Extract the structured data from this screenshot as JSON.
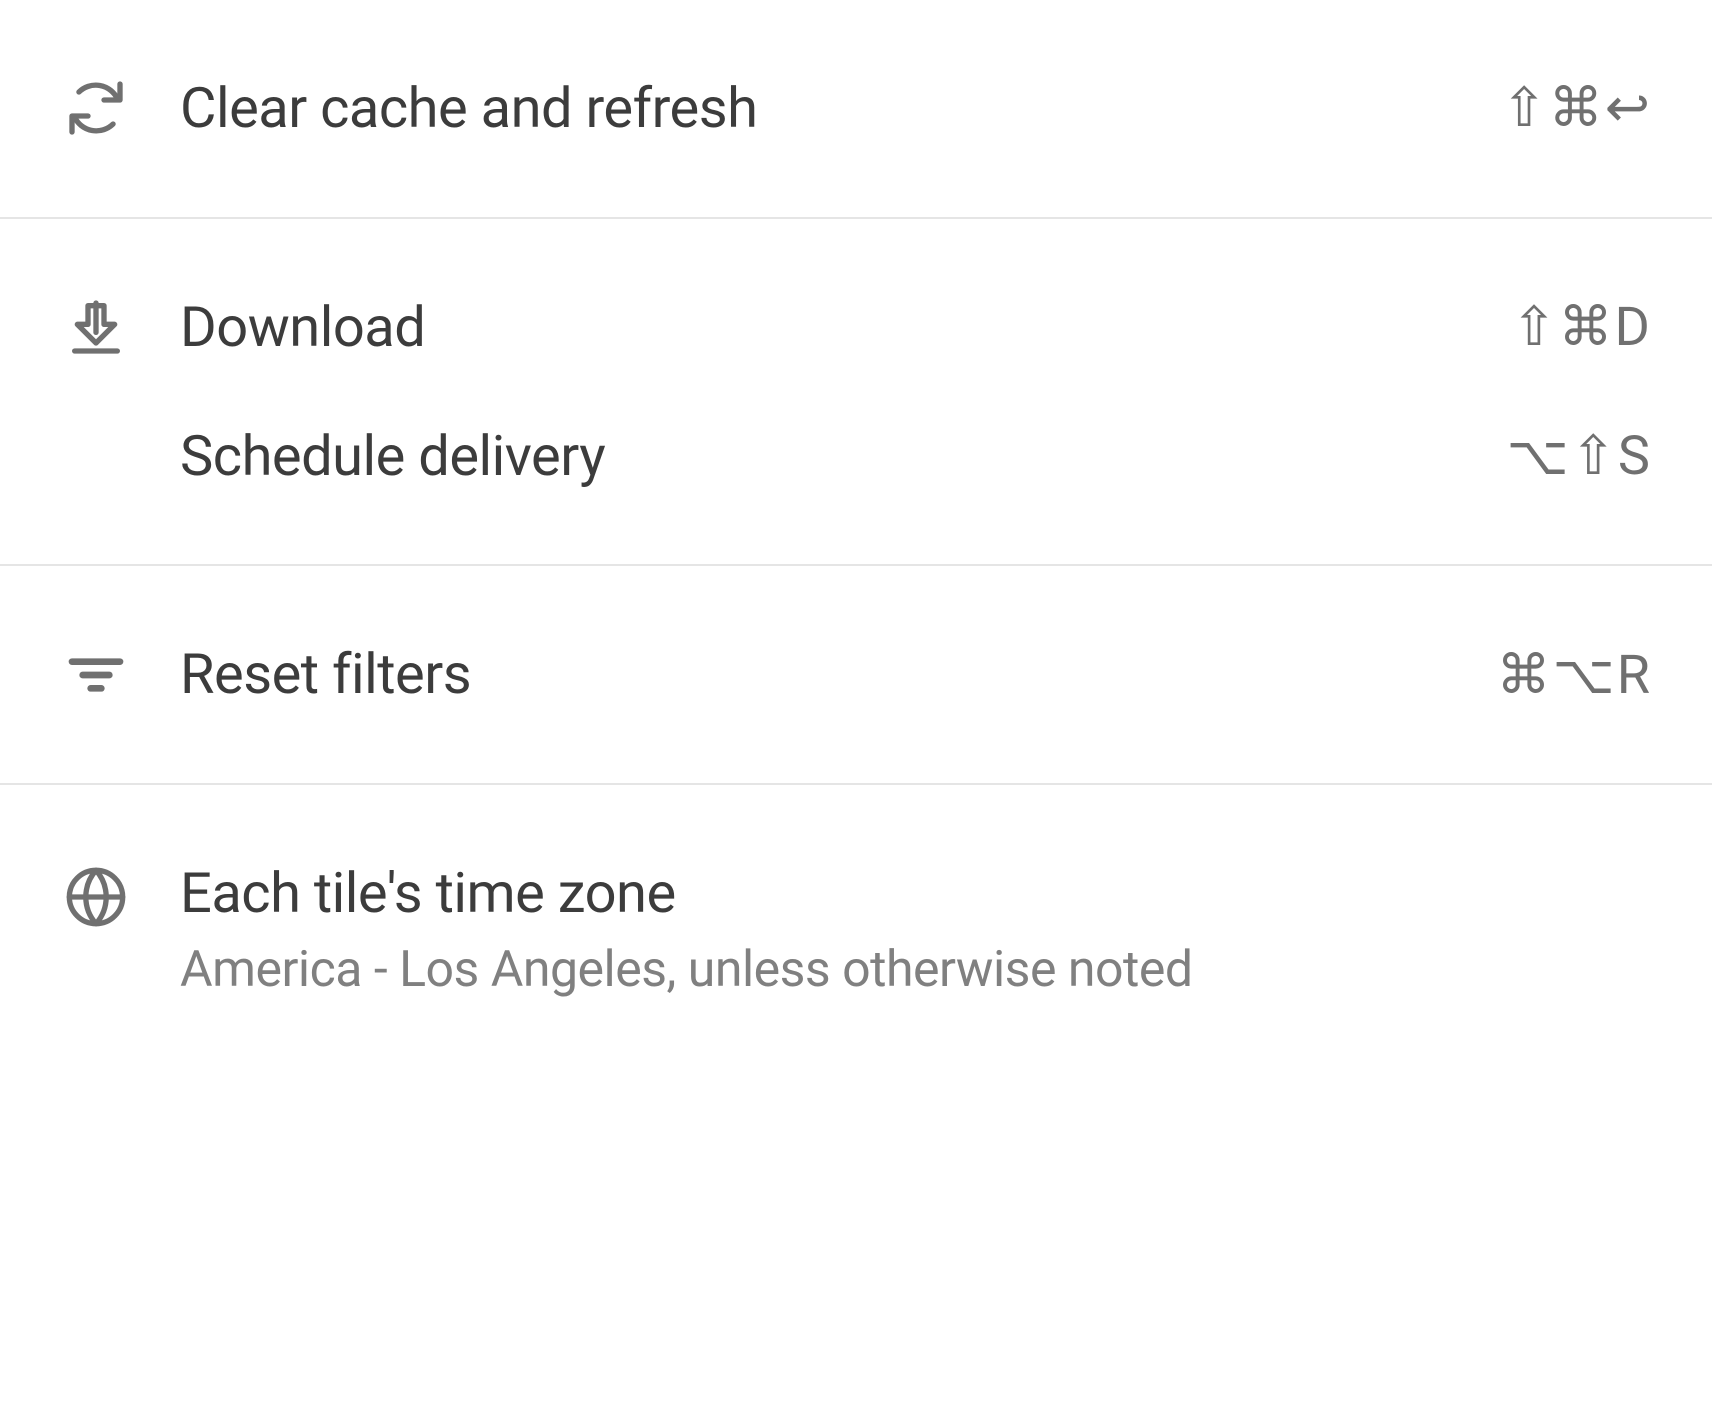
{
  "menu": {
    "section1": {
      "clear_cache": {
        "label": "Clear cache and refresh",
        "shortcut": "⇧⌘↩"
      }
    },
    "section2": {
      "download": {
        "label": "Download",
        "shortcut": "⇧⌘D"
      },
      "schedule_delivery": {
        "label": "Schedule delivery",
        "shortcut": "⌥⇧S"
      }
    },
    "section3": {
      "reset_filters": {
        "label": "Reset filters",
        "shortcut": "⌘⌥R"
      }
    },
    "section4": {
      "timezone": {
        "label": "Each tile's time zone",
        "sublabel": "America - Los Angeles, unless otherwise noted"
      }
    }
  }
}
